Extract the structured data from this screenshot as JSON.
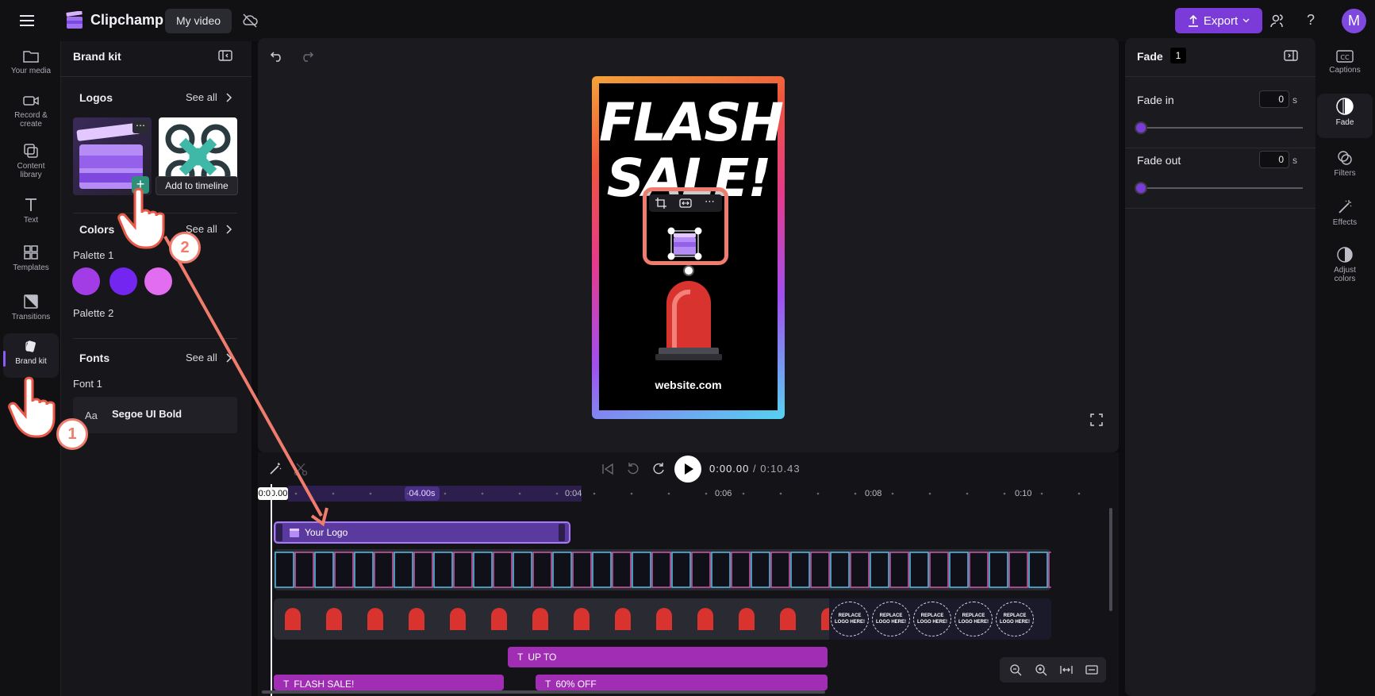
{
  "app": {
    "name": "Clipchamp",
    "project": "My video"
  },
  "topbar": {
    "export_label": "Export",
    "help_label": "?",
    "avatar_initial": "M"
  },
  "rail": {
    "items": [
      {
        "label": "Your media",
        "icon": "folder-icon"
      },
      {
        "label": "Record & create",
        "icon": "camera-icon"
      },
      {
        "label": "Content library",
        "icon": "library-icon"
      },
      {
        "label": "Text",
        "icon": "text-icon"
      },
      {
        "label": "Templates",
        "icon": "templates-icon"
      },
      {
        "label": "Transitions",
        "icon": "transitions-icon"
      },
      {
        "label": "Brand kit",
        "icon": "brand-kit-icon"
      }
    ]
  },
  "brand_panel": {
    "title": "Brand kit",
    "logos": {
      "title": "Logos",
      "see_all": "See all",
      "tooltip": "Add to timeline"
    },
    "colors": {
      "title": "Colors",
      "see_all": "See all",
      "palette1": "Palette 1",
      "palette2": "Palette 2",
      "swatches": [
        "#a23ce6",
        "#7326ef",
        "#e36df0"
      ]
    },
    "fonts": {
      "title": "Fonts",
      "see_all": "See all",
      "font1": "Font 1",
      "sample": "Aa",
      "font_name": "Segoe UI Bold"
    }
  },
  "stage": {
    "headline_line1": "FLASH",
    "headline_line2": "SALE!",
    "website": "website.com"
  },
  "right_panel": {
    "title": "Fade",
    "badge": "1",
    "fade_in": {
      "label": "Fade in",
      "value": "0",
      "unit": "s",
      "level": 0
    },
    "fade_out": {
      "label": "Fade out",
      "value": "0",
      "unit": "s",
      "level": 0
    }
  },
  "right_rail": {
    "items": [
      {
        "label": "Captions",
        "icon": "captions-icon"
      },
      {
        "label": "Fade",
        "icon": "fade-icon"
      },
      {
        "label": "Filters",
        "icon": "filters-icon"
      },
      {
        "label": "Effects",
        "icon": "effects-icon"
      },
      {
        "label": "Adjust colors",
        "icon": "adjust-colors-icon"
      }
    ]
  },
  "timeline": {
    "current_time": "0:00.00",
    "total_time": "/ 0:10.43",
    "playhead_label": "0:00.00",
    "selection_label": "04.00s",
    "ticks": [
      "0:04",
      "0:06",
      "0:08",
      "0:10"
    ],
    "logo_clip": "Your Logo",
    "replace_logo_text": "REPLACE LOGO HERE!",
    "text_clips": [
      "UP TO",
      "FLASH SALE!",
      "60% OFF"
    ]
  },
  "annotations": {
    "step1": "1",
    "step2": "2"
  },
  "colors": {
    "accent": "#7a3bd9",
    "highlight": "#ef7c6c"
  }
}
